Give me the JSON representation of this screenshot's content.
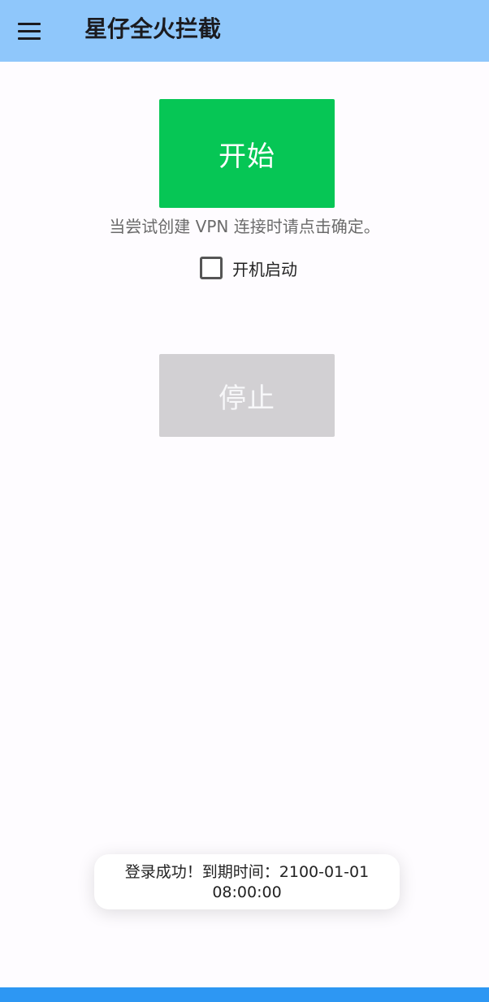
{
  "appbar": {
    "title": "星仔全火拦截"
  },
  "main": {
    "start_label": "开始",
    "hint_text": "当尝试创建 VPN 连接时请点击确定。",
    "boot_label": "开机启动",
    "boot_checked": false,
    "stop_label": "停止"
  },
  "toast": {
    "line1": "登录成功！到期时间：2100-01-01",
    "line2": "08:00:00"
  },
  "colors": {
    "appbar": "#8fc7fb",
    "start_button": "#06c655",
    "stop_button": "#d2d0d3",
    "bottom_strip": "#2d97f3"
  },
  "icons": {
    "menu": "hamburger-menu-icon"
  }
}
